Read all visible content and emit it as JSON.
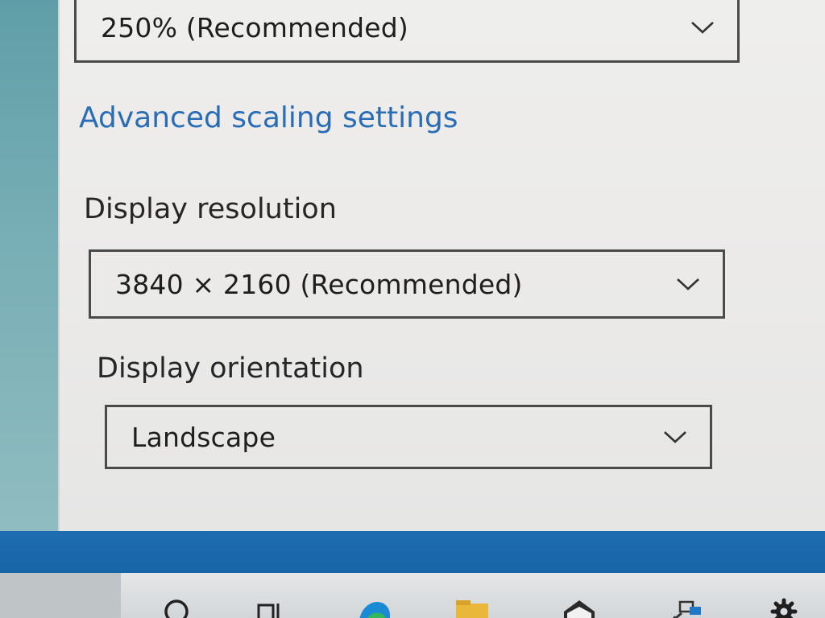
{
  "scale": {
    "value": "250% (Recommended)"
  },
  "advanced_scaling_link": "Advanced scaling settings",
  "resolution": {
    "label": "Display resolution",
    "value": "3840 × 2160 (Recommended)"
  },
  "orientation": {
    "label": "Display orientation",
    "value": "Landscape"
  },
  "taskbar": {
    "icons": [
      "search-icon",
      "task-view-icon",
      "edge-browser-icon",
      "file-explorer-icon",
      "mail-icon",
      "network-app-icon",
      "settings-gear-icon"
    ]
  },
  "colors": {
    "link": "#2a6db5",
    "taskbar_blue": "#1d6db0",
    "text": "#262626"
  }
}
